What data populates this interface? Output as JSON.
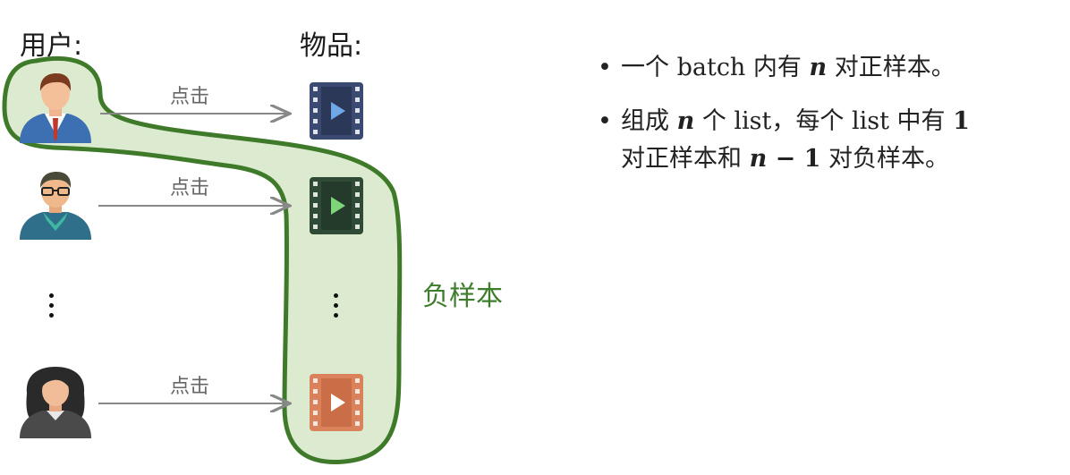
{
  "headers": {
    "users": "用户:",
    "items": "物品:"
  },
  "click_label": "点击",
  "negative_label": "负样本",
  "bullets": [
    {
      "pre": "一个 batch 内有 ",
      "var": "n",
      "post": " 对正样本。"
    },
    {
      "pre": "组成 ",
      "var": "n",
      "mid": " 个 list，每个 list 中有 ",
      "num": "1",
      "line2_pre": "对正样本和 ",
      "var2": "n",
      "minus": " − 1",
      "line2_post": " 对负样本。"
    }
  ],
  "colors": {
    "highlight_fill": "#dcebd0",
    "highlight_stroke": "#3f7a2a",
    "arrow": "#888888",
    "video_blue": "#3b4a72",
    "video_green": "#2f4a35",
    "video_orange": "#d9825c"
  },
  "icons": [
    "user-male-icon",
    "user-glasses-icon",
    "user-female-icon",
    "video-icon"
  ]
}
